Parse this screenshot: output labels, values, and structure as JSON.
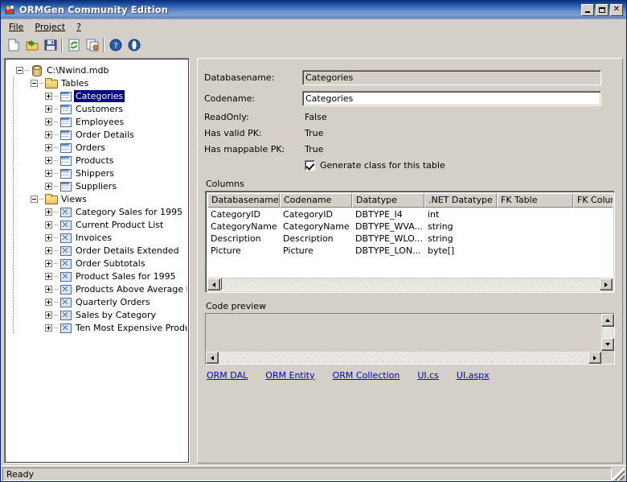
{
  "window": {
    "title": "ORMGen Community Edition",
    "icon": "app-icon",
    "min_label": "Minimize",
    "max_label": "Maximize",
    "close_label": "Close"
  },
  "menu": {
    "items": [
      {
        "label": "File",
        "accel": "F"
      },
      {
        "label": "Project",
        "accel": "P"
      },
      {
        "label": "?",
        "accel": "?"
      }
    ]
  },
  "toolbar": {
    "buttons": [
      {
        "name": "new-icon",
        "title": "New"
      },
      {
        "name": "open-folder-icon",
        "title": "Open"
      },
      {
        "name": "save-disk-icon",
        "title": "Save"
      },
      {
        "name": "refresh-icon",
        "title": "Refresh"
      },
      {
        "name": "generate-icon",
        "title": "Generate"
      },
      {
        "name": "help-icon",
        "title": "Help"
      },
      {
        "name": "about-icon",
        "title": "About"
      }
    ]
  },
  "tree": {
    "root": {
      "label": "C:\\Nwind.mdb",
      "icon": "database-icon",
      "expanded": true
    },
    "groups": [
      {
        "label": "Tables",
        "icon": "folder-icon",
        "expanded": true,
        "children": [
          {
            "label": "Categories",
            "icon": "table-icon",
            "selected": true
          },
          {
            "label": "Customers",
            "icon": "table-icon",
            "selected": false
          },
          {
            "label": "Employees",
            "icon": "table-icon",
            "selected": false
          },
          {
            "label": "Order Details",
            "icon": "table-icon",
            "selected": false
          },
          {
            "label": "Orders",
            "icon": "table-icon",
            "selected": false
          },
          {
            "label": "Products",
            "icon": "table-icon",
            "selected": false
          },
          {
            "label": "Shippers",
            "icon": "table-icon",
            "selected": false
          },
          {
            "label": "Suppliers",
            "icon": "table-icon",
            "selected": false
          }
        ]
      },
      {
        "label": "Views",
        "icon": "folder-icon",
        "expanded": true,
        "children": [
          {
            "label": "Category Sales for 1995",
            "icon": "view-icon",
            "selected": false
          },
          {
            "label": "Current Product List",
            "icon": "view-icon",
            "selected": false
          },
          {
            "label": "Invoices",
            "icon": "view-icon",
            "selected": false
          },
          {
            "label": "Order Details Extended",
            "icon": "view-icon",
            "selected": false
          },
          {
            "label": "Order Subtotals",
            "icon": "view-icon",
            "selected": false
          },
          {
            "label": "Product Sales for 1995",
            "icon": "view-icon",
            "selected": false
          },
          {
            "label": "Products Above Average Price",
            "icon": "view-icon",
            "selected": false
          },
          {
            "label": "Quarterly Orders",
            "icon": "view-icon",
            "selected": false
          },
          {
            "label": "Sales by Category",
            "icon": "view-icon",
            "selected": false
          },
          {
            "label": "Ten Most Expensive Products",
            "icon": "view-icon",
            "selected": false
          }
        ]
      }
    ]
  },
  "details": {
    "databasename_label": "Databasename:",
    "databasename_value": "Categories",
    "codename_label": "Codename:",
    "codename_value": "Categories",
    "readonly_label": "ReadOnly:",
    "readonly_value": "False",
    "haspk_label": "Has valid PK:",
    "haspk_value": "True",
    "hasmappable_label": "Has mappable PK:",
    "hasmappable_value": "True",
    "generate_checkbox_label": "Generate class for this table",
    "generate_checked": true
  },
  "columns_section": {
    "title": "Columns",
    "headers": [
      "Databasename",
      "Codename",
      "Datatype",
      ".NET Datatype",
      "FK Table",
      "FK Column"
    ],
    "rows": [
      [
        "CategoryID",
        "CategoryID",
        "DBTYPE_I4",
        "int",
        "",
        ""
      ],
      [
        "CategoryName",
        "CategoryName",
        "DBTYPE_WVA...",
        "string",
        "",
        ""
      ],
      [
        "Description",
        "Description",
        "DBTYPE_WLO...",
        "string",
        "",
        ""
      ],
      [
        "Picture",
        "Picture",
        "DBTYPE_LON...",
        "byte[]",
        "",
        ""
      ]
    ]
  },
  "code_preview": {
    "title": "Code preview",
    "content": ""
  },
  "links": [
    {
      "label": "ORM DAL"
    },
    {
      "label": "ORM Entity"
    },
    {
      "label": "ORM Collection"
    },
    {
      "label": "UI.cs"
    },
    {
      "label": "UI.aspx"
    }
  ],
  "statusbar": {
    "text": "Ready"
  },
  "colors": {
    "titlebar_start": "#0a2a77",
    "titlebar_end": "#8fa7cf",
    "face": "#d4d0c8",
    "selection": "#000080",
    "link": "#0000cc"
  }
}
